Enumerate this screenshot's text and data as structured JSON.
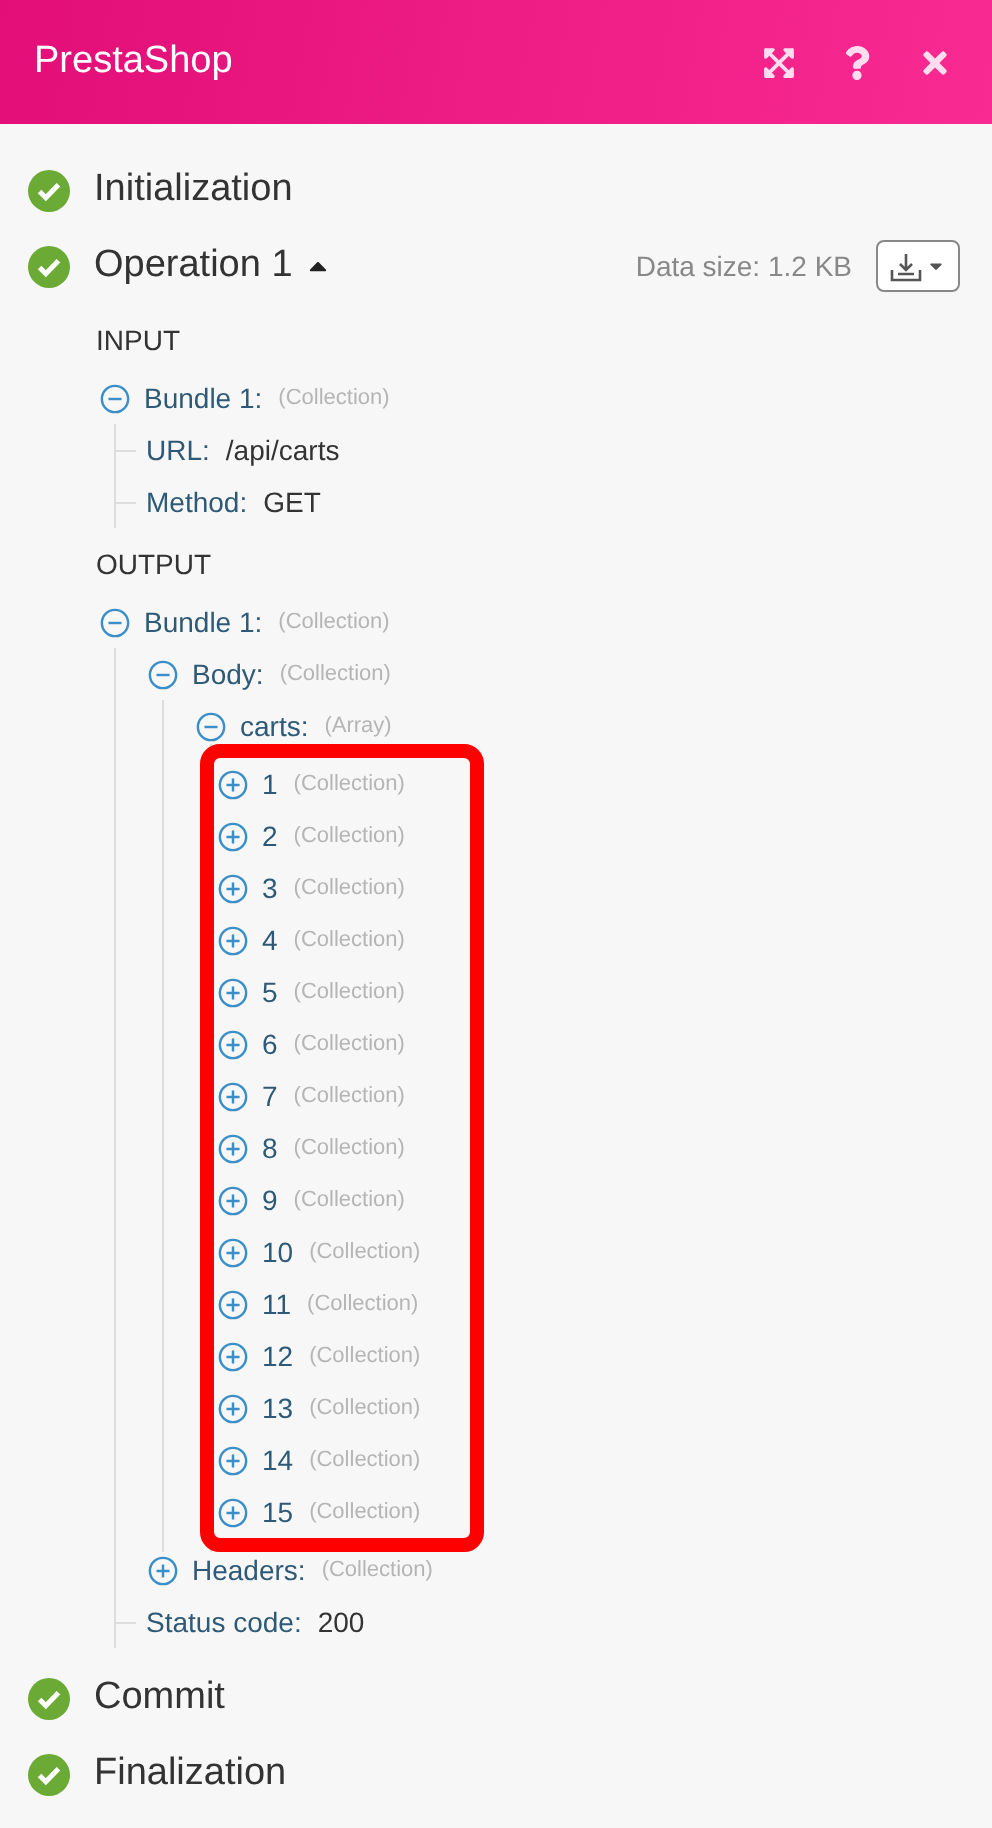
{
  "header": {
    "title": "PrestaShop"
  },
  "steps": [
    {
      "label": "Initialization",
      "done": true
    },
    {
      "label": "Operation 1",
      "done": true,
      "expanded": true,
      "data_size": "Data size: 1.2 KB",
      "sections": [
        {
          "title": "INPUT",
          "tree": [
            {
              "kind": "node",
              "key": "Bundle 1:",
              "type": "(Collection)",
              "expanded": true,
              "children": [
                {
                  "kind": "leaf",
                  "key": "URL:",
                  "value": "/api/carts"
                },
                {
                  "kind": "leaf",
                  "key": "Method:",
                  "value": "GET"
                }
              ]
            }
          ]
        },
        {
          "title": "OUTPUT",
          "tree": [
            {
              "kind": "node",
              "key": "Bundle 1:",
              "type": "(Collection)",
              "expanded": true,
              "children": [
                {
                  "kind": "node",
                  "key": "Body:",
                  "type": "(Collection)",
                  "expanded": true,
                  "children": [
                    {
                      "kind": "node",
                      "key": "carts:",
                      "type": "(Array)",
                      "expanded": true,
                      "highlighted": true,
                      "children": [
                        {
                          "kind": "node",
                          "key": "1",
                          "type": "(Collection)",
                          "expanded": false
                        },
                        {
                          "kind": "node",
                          "key": "2",
                          "type": "(Collection)",
                          "expanded": false
                        },
                        {
                          "kind": "node",
                          "key": "3",
                          "type": "(Collection)",
                          "expanded": false
                        },
                        {
                          "kind": "node",
                          "key": "4",
                          "type": "(Collection)",
                          "expanded": false
                        },
                        {
                          "kind": "node",
                          "key": "5",
                          "type": "(Collection)",
                          "expanded": false
                        },
                        {
                          "kind": "node",
                          "key": "6",
                          "type": "(Collection)",
                          "expanded": false
                        },
                        {
                          "kind": "node",
                          "key": "7",
                          "type": "(Collection)",
                          "expanded": false
                        },
                        {
                          "kind": "node",
                          "key": "8",
                          "type": "(Collection)",
                          "expanded": false
                        },
                        {
                          "kind": "node",
                          "key": "9",
                          "type": "(Collection)",
                          "expanded": false
                        },
                        {
                          "kind": "node",
                          "key": "10",
                          "type": "(Collection)",
                          "expanded": false
                        },
                        {
                          "kind": "node",
                          "key": "11",
                          "type": "(Collection)",
                          "expanded": false
                        },
                        {
                          "kind": "node",
                          "key": "12",
                          "type": "(Collection)",
                          "expanded": false
                        },
                        {
                          "kind": "node",
                          "key": "13",
                          "type": "(Collection)",
                          "expanded": false
                        },
                        {
                          "kind": "node",
                          "key": "14",
                          "type": "(Collection)",
                          "expanded": false
                        },
                        {
                          "kind": "node",
                          "key": "15",
                          "type": "(Collection)",
                          "expanded": false
                        }
                      ]
                    }
                  ]
                },
                {
                  "kind": "node",
                  "key": "Headers:",
                  "type": "(Collection)",
                  "expanded": false
                },
                {
                  "kind": "leaf",
                  "key": "Status code:",
                  "value": "200"
                }
              ]
            }
          ]
        }
      ]
    },
    {
      "label": "Commit",
      "done": true
    },
    {
      "label": "Finalization",
      "done": true
    }
  ]
}
